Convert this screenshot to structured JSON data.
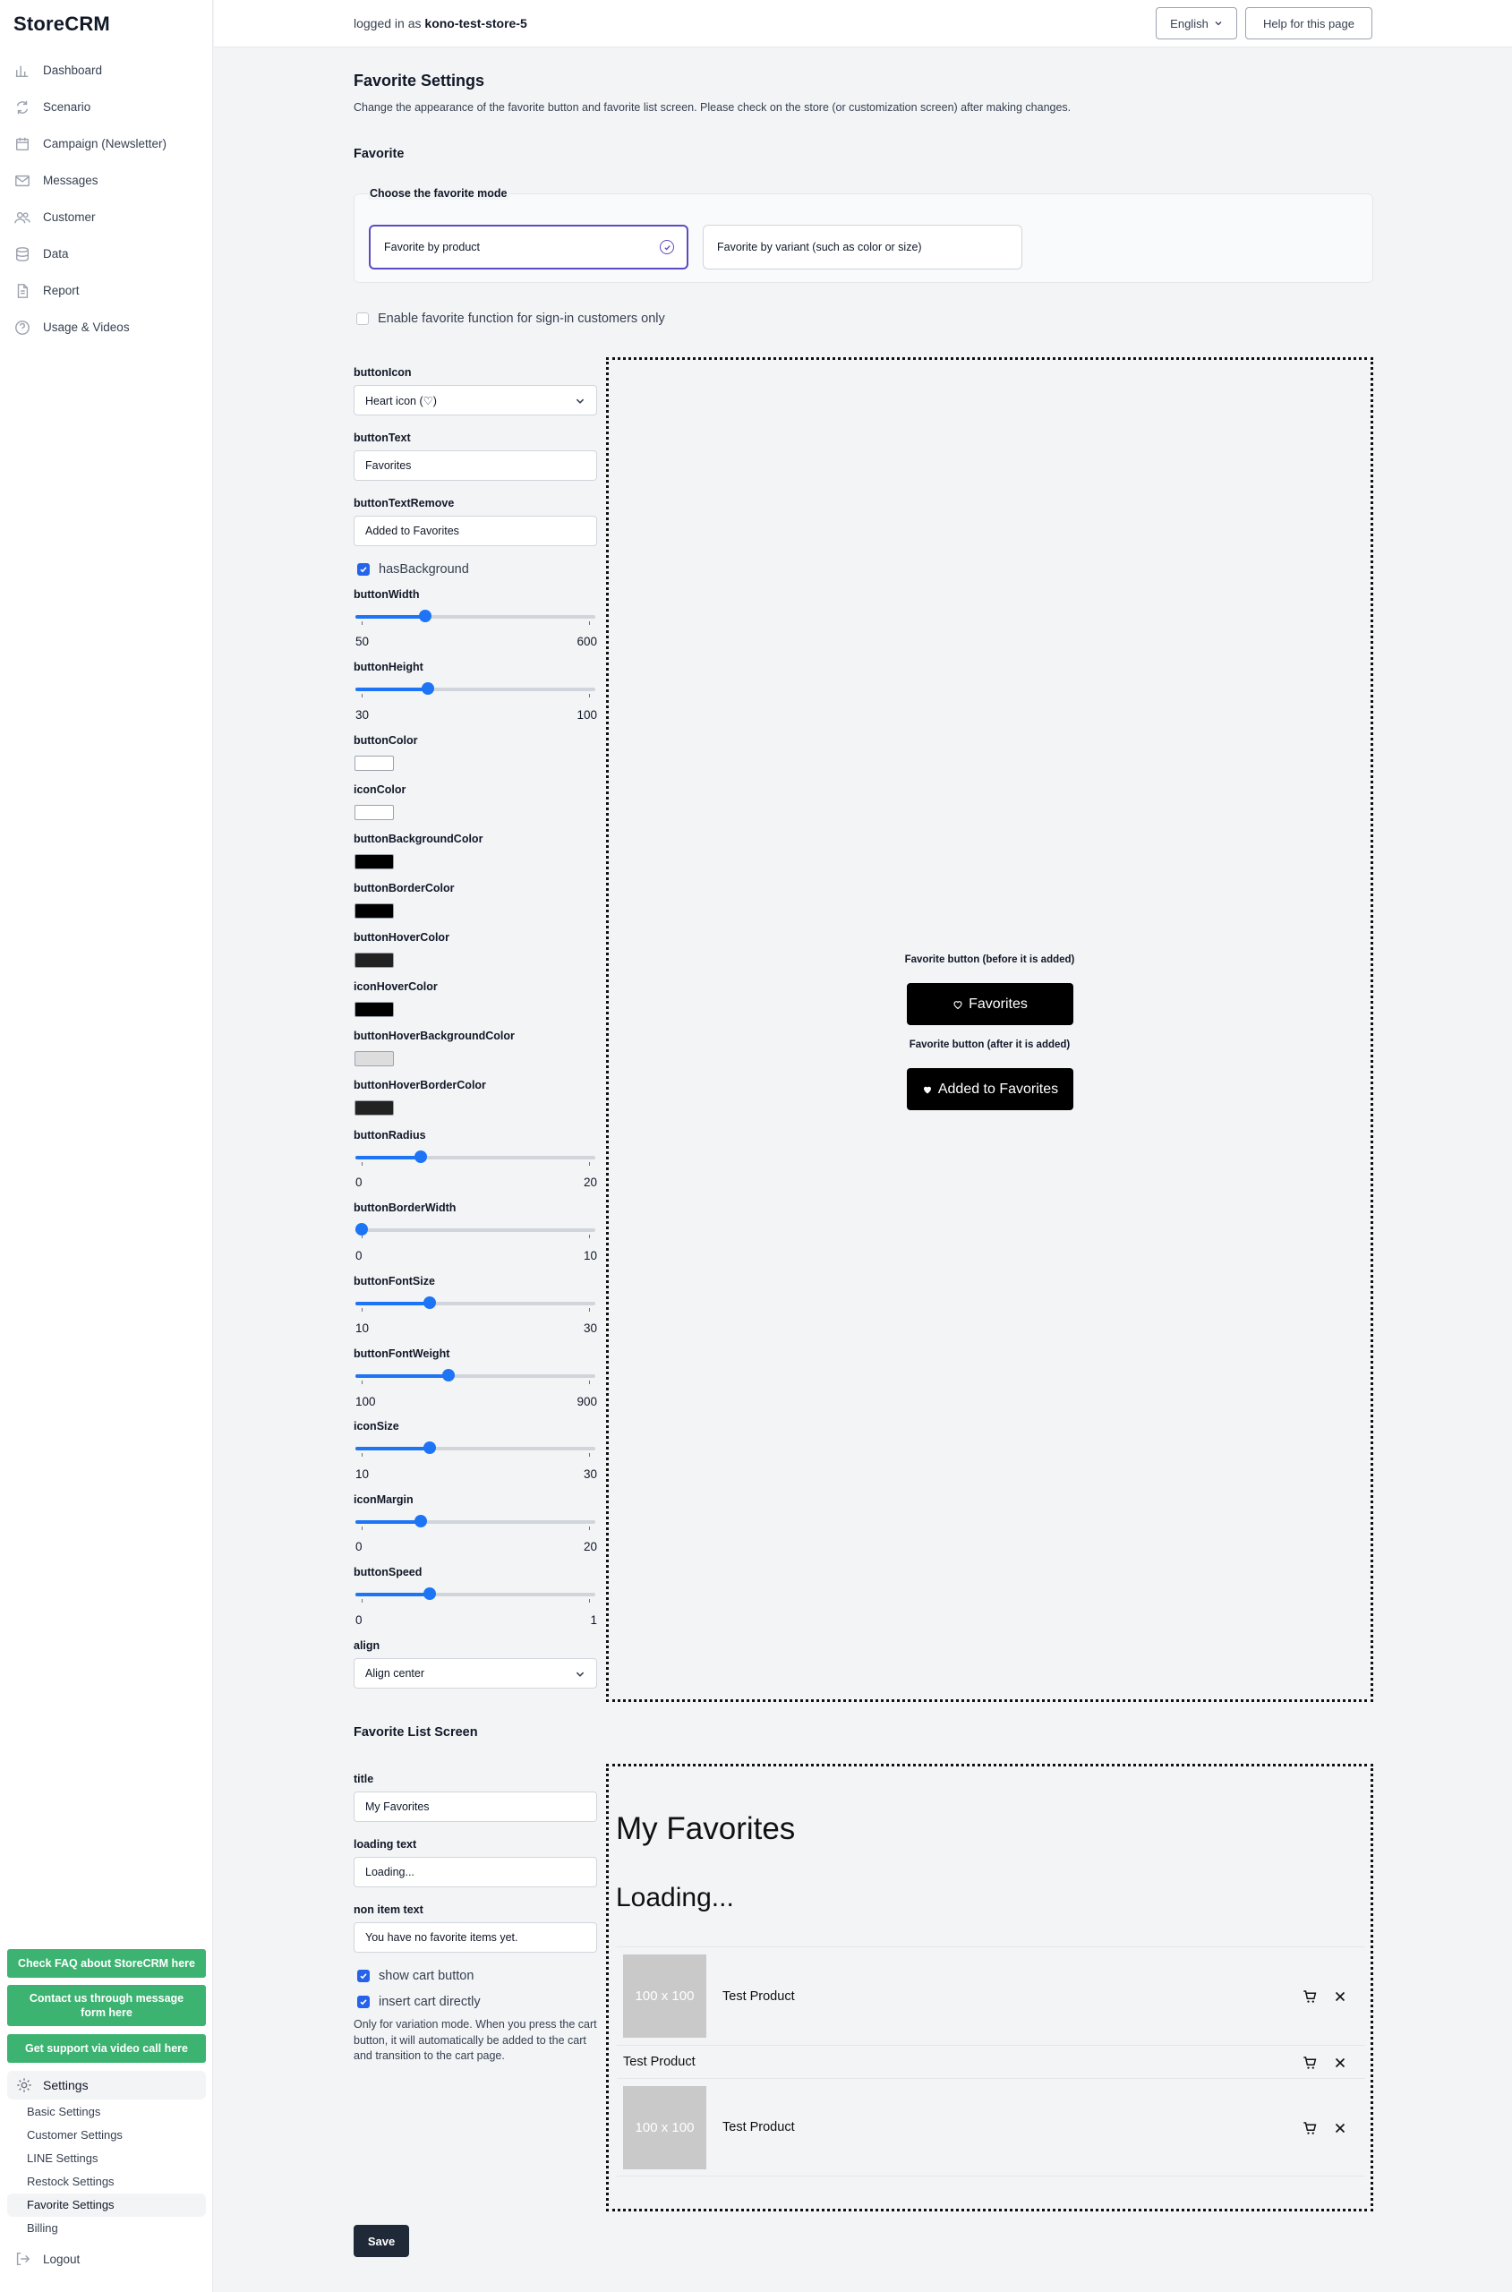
{
  "app": {
    "name": "StoreCRM"
  },
  "sidebar": {
    "items": [
      {
        "label": "Dashboard",
        "icon": "chart-bar-icon"
      },
      {
        "label": "Scenario",
        "icon": "refresh-icon"
      },
      {
        "label": "Campaign (Newsletter)",
        "icon": "calendar-icon"
      },
      {
        "label": "Messages",
        "icon": "envelope-icon"
      },
      {
        "label": "Customer",
        "icon": "users-icon"
      },
      {
        "label": "Data",
        "icon": "database-icon"
      },
      {
        "label": "Report",
        "icon": "document-icon"
      },
      {
        "label": "Usage & Videos",
        "icon": "question-circle-icon"
      }
    ],
    "faq_button": "Check FAQ about StoreCRM here",
    "contact_button": "Contact us through message form here",
    "support_button": "Get support via video call here",
    "settings_label": "Settings",
    "settings_items": [
      "Basic Settings",
      "Customer Settings",
      "LINE Settings",
      "Restock Settings",
      "Favorite Settings",
      "Billing"
    ],
    "active_settings_item": "Favorite Settings",
    "logout_label": "Logout",
    "accent_green": "#3cb371"
  },
  "header": {
    "login_prefix": "logged in as",
    "login_user": "kono-test-store-5",
    "language": "English",
    "help": "Help for this page"
  },
  "page": {
    "title": "Favorite Settings",
    "description": "Change the appearance of the favorite button and favorite list screen. Please check on the store (or customization screen) after making changes."
  },
  "favorite": {
    "section_title": "Favorite",
    "mode_legend": "Choose the favorite mode",
    "mode_options": [
      "Favorite by product",
      "Favorite by variant (such as color or size)"
    ],
    "selected_mode": "Favorite by product",
    "signin_only_label": "Enable favorite function for sign-in customers only",
    "signin_only": false
  },
  "settings": {
    "buttonIcon": {
      "label": "buttonIcon",
      "value": "Heart icon (♡)"
    },
    "buttonText": {
      "label": "buttonText",
      "value": "Favorites"
    },
    "buttonTextRemove": {
      "label": "buttonTextRemove",
      "value": "Added to Favorites"
    },
    "hasBackground": {
      "label": "hasBackground",
      "checked": true
    },
    "sliders": [
      {
        "key": "buttonWidth",
        "label": "buttonWidth",
        "min": "50",
        "max": "600",
        "fraction": 0.28
      },
      {
        "key": "buttonHeight",
        "label": "buttonHeight",
        "min": "30",
        "max": "100",
        "fraction": 0.29
      },
      {
        "key": "buttonRadius",
        "label": "buttonRadius",
        "min": "0",
        "max": "20",
        "fraction": 0.26
      },
      {
        "key": "buttonBorderWidth",
        "label": "buttonBorderWidth",
        "min": "0",
        "max": "10",
        "fraction": 0.0
      },
      {
        "key": "buttonFontSize",
        "label": "buttonFontSize",
        "min": "10",
        "max": "30",
        "fraction": 0.3
      },
      {
        "key": "buttonFontWeight",
        "label": "buttonFontWeight",
        "min": "100",
        "max": "900",
        "fraction": 0.38
      },
      {
        "key": "iconSize",
        "label": "iconSize",
        "min": "10",
        "max": "30",
        "fraction": 0.3
      },
      {
        "key": "iconMargin",
        "label": "iconMargin",
        "min": "0",
        "max": "20",
        "fraction": 0.26
      },
      {
        "key": "buttonSpeed",
        "label": "buttonSpeed",
        "min": "0",
        "max": "1",
        "fraction": 0.3
      }
    ],
    "colors": [
      {
        "label": "buttonColor",
        "value": "#ffffff"
      },
      {
        "label": "iconColor",
        "value": "#ffffff"
      },
      {
        "label": "buttonBackgroundColor",
        "value": "#000000"
      },
      {
        "label": "buttonBorderColor",
        "value": "#000000"
      },
      {
        "label": "buttonHoverColor",
        "value": "#222222"
      },
      {
        "label": "iconHoverColor",
        "value": "#000000"
      },
      {
        "label": "buttonHoverBackgroundColor",
        "value": "#dddddd"
      },
      {
        "label": "buttonHoverBorderColor",
        "value": "#222222"
      }
    ],
    "align": {
      "label": "align",
      "value": "Align center"
    }
  },
  "preview": {
    "before_caption": "Favorite button (before it is added)",
    "before_text": "Favorites",
    "after_caption": "Favorite button (after it is added)",
    "after_text": "Added to Favorites"
  },
  "list_screen": {
    "section_title": "Favorite List Screen",
    "title": {
      "label": "title",
      "value": "My Favorites"
    },
    "loading_text": {
      "label": "loading text",
      "value": "Loading..."
    },
    "non_item_text": {
      "label": "non item text",
      "value": "You have no favorite items yet."
    },
    "show_cart_button": {
      "label": "show cart button",
      "checked": true
    },
    "insert_cart_directly": {
      "label": "insert cart directly",
      "checked": true
    },
    "note": "Only for variation mode. When you press the cart button, it will automatically be added to the cart and transition to the cart page."
  },
  "list_preview": {
    "title": "My Favorites",
    "loading": "Loading...",
    "items": [
      {
        "name": "Test Product",
        "image_text": "100 x 100",
        "has_image": true
      },
      {
        "name": "Test Product",
        "has_image": false
      },
      {
        "name": "Test Product",
        "image_text": "100 x 100",
        "has_image": true
      }
    ]
  },
  "save_label": "Save"
}
